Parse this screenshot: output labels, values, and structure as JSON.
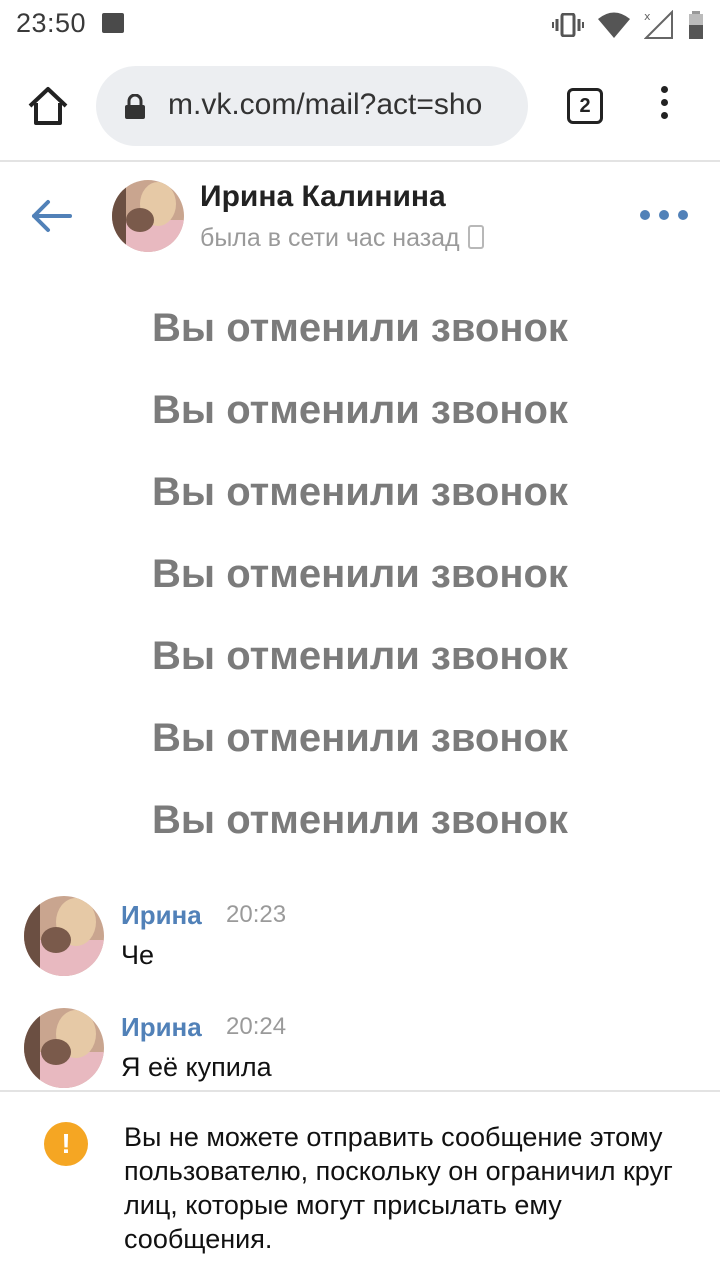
{
  "status_bar": {
    "time": "23:50",
    "icons": [
      "image-icon",
      "vibrate-icon",
      "wifi-icon",
      "signal-icon",
      "battery-icon"
    ]
  },
  "browser": {
    "url": "m.vk.com/mail?act=sho",
    "tab_count": "2",
    "icons": [
      "home-icon",
      "lock-icon",
      "menu-icon"
    ]
  },
  "chat": {
    "contact_name": "Ирина Калинина",
    "contact_status": "была в сети час назад",
    "icons": [
      "back-arrow-icon",
      "more-icon",
      "mobile-icon"
    ],
    "accent_color": "#5181b8"
  },
  "system_messages": [
    "Вы отменили звонок",
    "Вы отменили звонок",
    "Вы отменили звонок",
    "Вы отменили звонок",
    "Вы отменили звонок",
    "Вы отменили звонок",
    "Вы отменили звонок"
  ],
  "messages": [
    {
      "author": "Ирина",
      "time": "20:23",
      "text": "Че"
    },
    {
      "author": "Ирина",
      "time": "20:24",
      "text": "Я её купила"
    }
  ],
  "notice": {
    "icon": "warning-icon",
    "color": "#f5a623",
    "symbol": "!",
    "text": "Вы не можете отправить сообщение этому пользователю, поскольку он ограничил круг лиц, которые могут присылать ему сообщения."
  }
}
